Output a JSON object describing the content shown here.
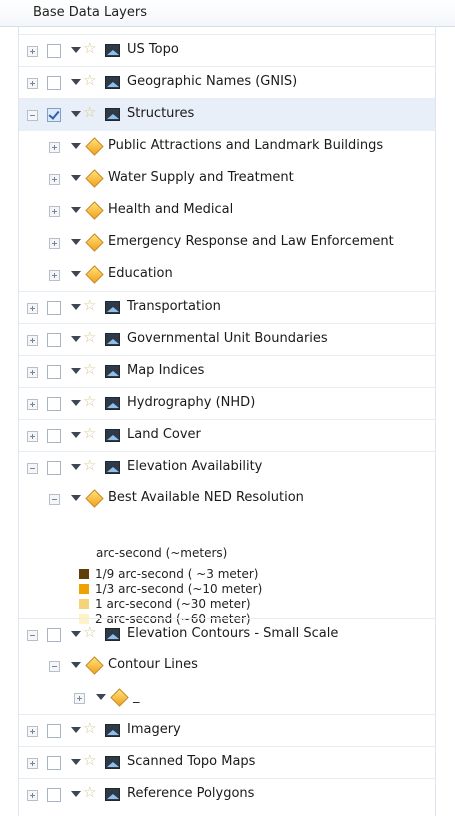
{
  "panel": {
    "title": "Base Data Layers"
  },
  "layers": [
    {
      "label": "US Topo",
      "level": 0,
      "expanded": false,
      "checked": false,
      "icon": "layer-icon"
    },
    {
      "label": "Geographic Names (GNIS)",
      "level": 0,
      "expanded": false,
      "checked": false,
      "icon": "layer-icon"
    },
    {
      "label": "Structures",
      "level": 0,
      "expanded": true,
      "checked": true,
      "selected": true,
      "icon": "layer-icon"
    },
    {
      "label": "Public Attractions and Landmark Buildings",
      "level": 1,
      "expanded": false,
      "icon": "feature-diamond-icon"
    },
    {
      "label": "Water Supply and Treatment",
      "level": 1,
      "expanded": false,
      "icon": "feature-diamond-icon"
    },
    {
      "label": "Health and Medical",
      "level": 1,
      "expanded": false,
      "icon": "feature-diamond-icon"
    },
    {
      "label": "Emergency Response and Law Enforcement",
      "level": 1,
      "expanded": false,
      "icon": "feature-diamond-icon"
    },
    {
      "label": "Education",
      "level": 1,
      "expanded": false,
      "icon": "feature-diamond-icon"
    },
    {
      "label": "Transportation",
      "level": 0,
      "expanded": false,
      "checked": false,
      "icon": "layer-icon"
    },
    {
      "label": "Governmental Unit Boundaries",
      "level": 0,
      "expanded": false,
      "checked": false,
      "icon": "layer-icon"
    },
    {
      "label": "Map Indices",
      "level": 0,
      "expanded": false,
      "checked": false,
      "icon": "layer-icon"
    },
    {
      "label": "Hydrography (NHD)",
      "level": 0,
      "expanded": false,
      "checked": false,
      "icon": "layer-icon"
    },
    {
      "label": "Land Cover",
      "level": 0,
      "expanded": false,
      "checked": false,
      "icon": "layer-icon"
    },
    {
      "label": "Elevation Availability",
      "level": 0,
      "expanded": true,
      "checked": false,
      "icon": "layer-icon"
    },
    {
      "label": "Best Available NED Resolution",
      "level": 1,
      "expanded": true,
      "icon": "feature-diamond-icon"
    },
    {
      "label": "Elevation Contours - Small Scale",
      "level": 0,
      "expanded": true,
      "checked": false,
      "icon": "layer-icon"
    },
    {
      "label": "Contour Lines",
      "level": 1,
      "expanded": true,
      "icon": "feature-diamond-icon"
    },
    {
      "label": "_",
      "level": 2,
      "expanded": false,
      "icon": "feature-diamond-icon"
    },
    {
      "label": "Imagery",
      "level": 0,
      "expanded": false,
      "checked": false,
      "icon": "layer-icon"
    },
    {
      "label": "Scanned Topo Maps",
      "level": 0,
      "expanded": false,
      "checked": false,
      "icon": "layer-icon"
    },
    {
      "label": "Reference Polygons",
      "level": 0,
      "expanded": false,
      "checked": false,
      "icon": "layer-icon"
    }
  ],
  "legend": {
    "title": "arc-second (~meters)",
    "items": [
      {
        "label": "1/9 arc-second ( ~3 meter)",
        "color": "#5e3f0a"
      },
      {
        "label": "1/3 arc-second (~10 meter)",
        "color": "#f0a000"
      },
      {
        "label": "1 arc-second (~30 meter)",
        "color": "#f6d27a"
      },
      {
        "label": "2 arc-second (~60 meter)",
        "color": "#fff3c4"
      }
    ]
  },
  "colors": {
    "selected_row": "#e9eff8",
    "diamond": "#f1a21c"
  }
}
